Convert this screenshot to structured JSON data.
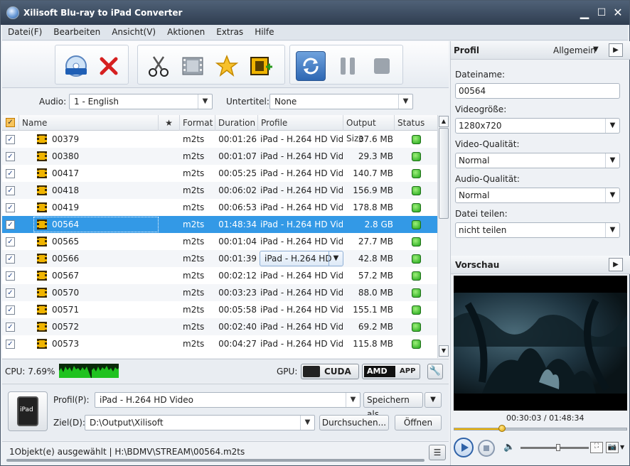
{
  "window": {
    "title": "Xilisoft Blu-ray to iPad Converter",
    "minimize": "▁",
    "maximize": "☐",
    "close": "✕"
  },
  "menu": [
    "Datei(F)",
    "Bearbeiten",
    "Ansicht(V)",
    "Aktionen",
    "Extras",
    "Hilfe"
  ],
  "toolbar": {
    "icons": [
      "blu-ray-disc-icon",
      "delete-icon",
      "cut-icon",
      "film-clip-icon",
      "star-effects-icon",
      "add-video-icon",
      "convert-icon",
      "pause-icon",
      "stop-icon"
    ]
  },
  "audio": {
    "label": "Audio:",
    "value": "1 - English"
  },
  "subtitle": {
    "label": "Untertitel:",
    "value": "None"
  },
  "table": {
    "columns": [
      "Name",
      "★",
      "Format",
      "Duration",
      "Profile",
      "Output Size",
      "Status"
    ],
    "rows": [
      {
        "name": "00379",
        "format": "m2ts",
        "duration": "00:01:26",
        "profile": "iPad - H.264 HD Vid...",
        "size": "37.6 MB",
        "checked": true
      },
      {
        "name": "00380",
        "format": "m2ts",
        "duration": "00:01:07",
        "profile": "iPad - H.264 HD Vid...",
        "size": "29.3 MB",
        "checked": true
      },
      {
        "name": "00417",
        "format": "m2ts",
        "duration": "00:05:25",
        "profile": "iPad - H.264 HD Vid...",
        "size": "140.7 MB",
        "checked": true
      },
      {
        "name": "00418",
        "format": "m2ts",
        "duration": "00:06:02",
        "profile": "iPad - H.264 HD Vid...",
        "size": "156.9 MB",
        "checked": true
      },
      {
        "name": "00419",
        "format": "m2ts",
        "duration": "00:06:53",
        "profile": "iPad - H.264 HD Vid...",
        "size": "178.8 MB",
        "checked": true
      },
      {
        "name": "00564",
        "format": "m2ts",
        "duration": "01:48:34",
        "profile": "iPad - H.264 HD Vid...",
        "size": "2.8 GB",
        "checked": true,
        "selected": true
      },
      {
        "name": "00565",
        "format": "m2ts",
        "duration": "00:01:04",
        "profile": "iPad - H.264 HD Vid...",
        "size": "27.7 MB",
        "checked": true
      },
      {
        "name": "00566",
        "format": "m2ts",
        "duration": "00:01:39",
        "profile": "iPad - H.264 HD",
        "size": "42.8 MB",
        "checked": true,
        "profile_dropdown": true
      },
      {
        "name": "00567",
        "format": "m2ts",
        "duration": "00:02:12",
        "profile": "iPad - H.264 HD Vid...",
        "size": "57.2 MB",
        "checked": true
      },
      {
        "name": "00570",
        "format": "m2ts",
        "duration": "00:03:23",
        "profile": "iPad - H.264 HD Vid...",
        "size": "88.0 MB",
        "checked": true
      },
      {
        "name": "00571",
        "format": "m2ts",
        "duration": "00:05:58",
        "profile": "iPad - H.264 HD Vid...",
        "size": "155.1 MB",
        "checked": true
      },
      {
        "name": "00572",
        "format": "m2ts",
        "duration": "00:02:40",
        "profile": "iPad - H.264 HD Vid...",
        "size": "69.2 MB",
        "checked": true
      },
      {
        "name": "00573",
        "format": "m2ts",
        "duration": "00:04:27",
        "profile": "iPad - H.264 HD Vid...",
        "size": "115.8 MB",
        "checked": true
      }
    ]
  },
  "cpu": {
    "label": "CPU: 7.69%",
    "gpu_label": "GPU:",
    "cuda": "CUDA",
    "amd": "AMD",
    "app": "APP"
  },
  "output": {
    "device": "iPad",
    "profile_label": "Profil(P):",
    "profile_value": "iPad - H.264 HD Video",
    "save_as": "Speichern als...",
    "dest_label": "Ziel(D):",
    "dest_value": "D:\\Output\\Xilisoft",
    "browse": "Durchsuchen...",
    "open": "Öffnen"
  },
  "status": {
    "text": "1Objekt(e) ausgewählt | H:\\BDMV\\STREAM\\00564.m2ts"
  },
  "profile_panel": {
    "title": "Profil",
    "mode": "Allgemein",
    "filename_label": "Dateiname:",
    "filename": "00564",
    "video_size_label": "Videogröße:",
    "video_size": "1280x720",
    "video_quality_label": "Video-Qualität:",
    "video_quality": "Normal",
    "audio_quality_label": "Audio-Qualität:",
    "audio_quality": "Normal",
    "split_label": "Datei teilen:",
    "split": "nicht teilen"
  },
  "preview": {
    "title": "Vorschau",
    "time": "00:30:03 / 01:48:34",
    "progress": 0.277
  }
}
